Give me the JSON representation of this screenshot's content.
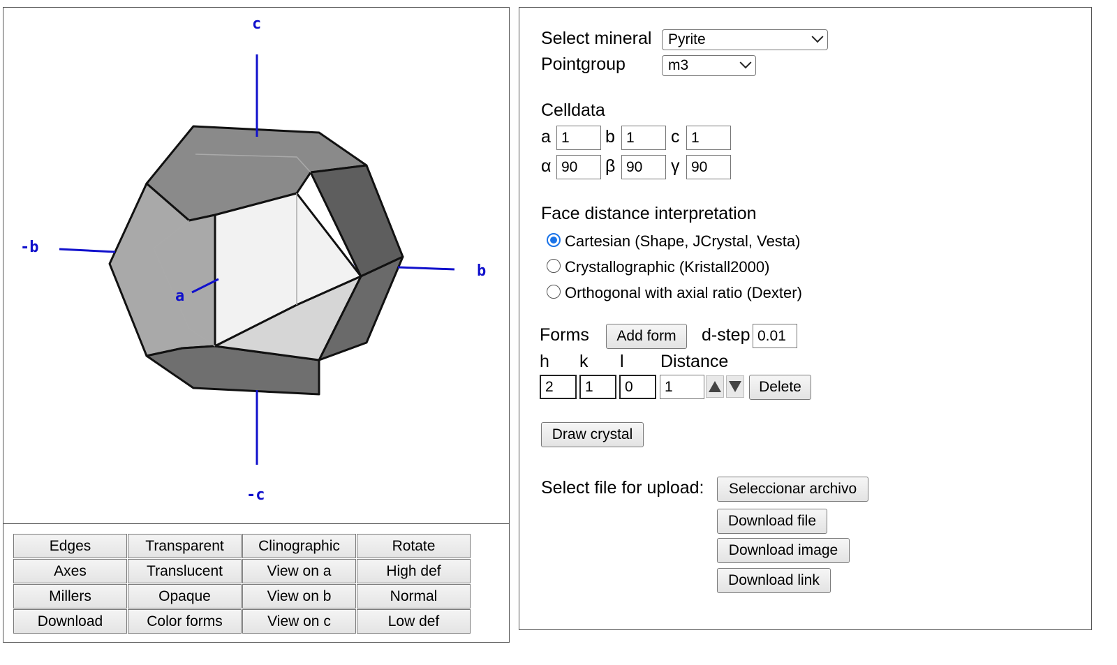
{
  "viewer": {
    "axis_labels": {
      "c": "c",
      "minus_c": "-c",
      "b": "b",
      "minus_b": "-b",
      "a": "a"
    },
    "buttons": [
      "Edges",
      "Transparent",
      "Clinographic",
      "Rotate",
      "Axes",
      "Translucent",
      "View on a",
      "High def",
      "Millers",
      "Opaque",
      "View on b",
      "Normal",
      "Download",
      "Color forms",
      "View on c",
      "Low def"
    ]
  },
  "controls": {
    "select_mineral_label": "Select mineral",
    "mineral_value": "Pyrite",
    "pointgroup_label": "Pointgroup",
    "pointgroup_value": "m3",
    "celldata_label": "Celldata",
    "cell": {
      "a_label": "a",
      "a": "1",
      "b_label": "b",
      "b": "1",
      "c_label": "c",
      "c": "1",
      "alpha_label": "α",
      "alpha": "90",
      "beta_label": "β",
      "beta": "90",
      "gamma_label": "γ",
      "gamma": "90"
    },
    "face_distance_label": "Face distance interpretation",
    "radios": [
      {
        "label": "Cartesian (Shape, JCrystal, Vesta)",
        "checked": true
      },
      {
        "label": "Crystallographic (Kristall2000)",
        "checked": false
      },
      {
        "label": "Orthogonal with axial ratio (Dexter)",
        "checked": false
      }
    ],
    "forms_label": "Forms",
    "add_form_label": "Add form",
    "dstep_label": "d-step",
    "dstep_value": "0.01",
    "form_headers": {
      "h": "h",
      "k": "k",
      "l": "l",
      "distance": "Distance"
    },
    "form_row": {
      "h": "2",
      "k": "1",
      "l": "0",
      "distance": "1"
    },
    "delete_label": "Delete",
    "draw_crystal_label": "Draw crystal",
    "upload_label": "Select file for upload:",
    "choose_file_label": "Seleccionar archivo",
    "download_file_label": "Download file",
    "download_image_label": "Download image",
    "download_link_label": "Download link"
  },
  "colors": {
    "axis": "#1010cc",
    "axis_faint": "#9a9af0",
    "radio_accent": "#1a73e8"
  }
}
